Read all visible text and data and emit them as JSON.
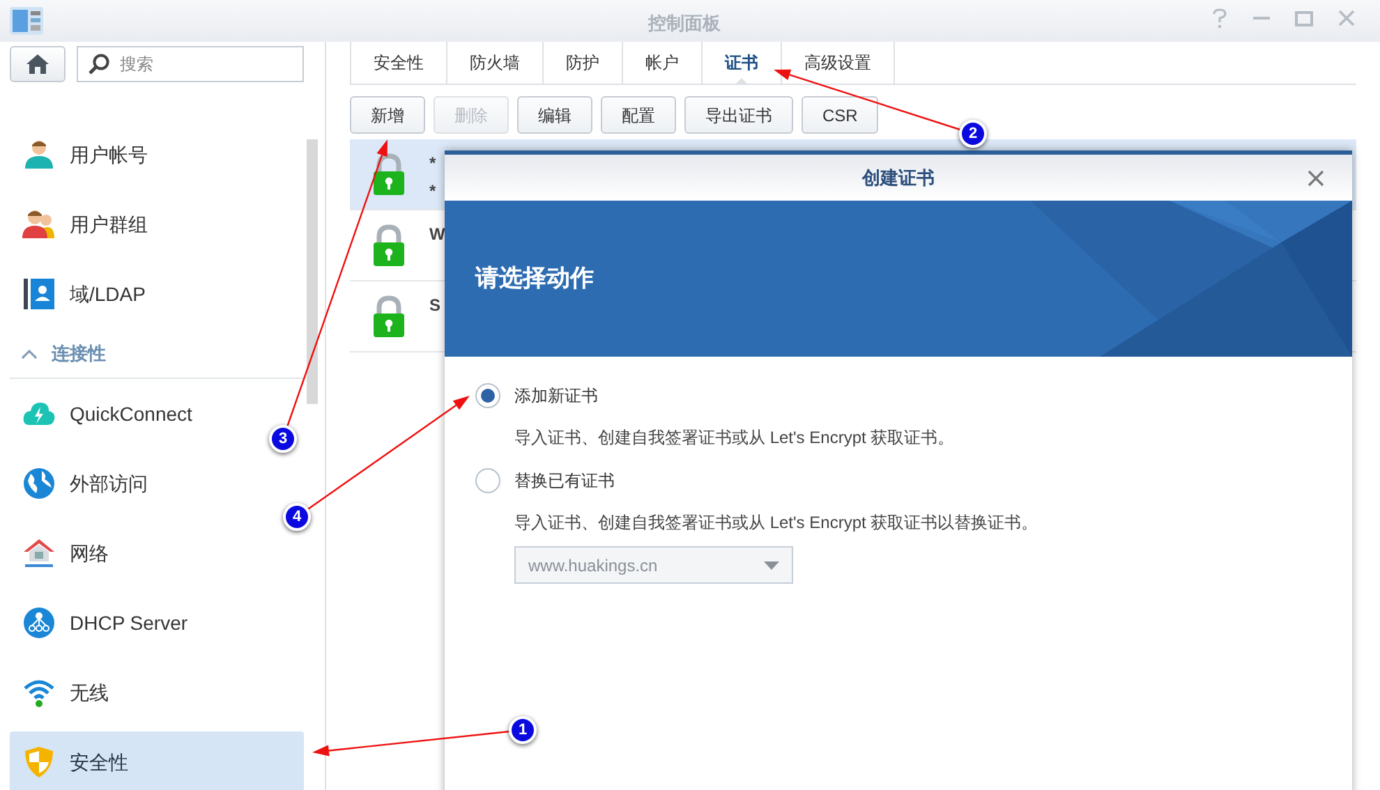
{
  "window": {
    "title": "控制面板"
  },
  "sidebar": {
    "search": {
      "placeholder": "搜索"
    },
    "items": [
      {
        "kind": "item",
        "label": "用户帐号",
        "selected": false
      },
      {
        "kind": "item",
        "label": "用户群组",
        "selected": false
      },
      {
        "kind": "item",
        "label": "域/LDAP",
        "selected": false
      },
      {
        "kind": "section",
        "label": "连接性",
        "expanded": true
      },
      {
        "kind": "item",
        "label": "QuickConnect",
        "selected": false
      },
      {
        "kind": "item",
        "label": "外部访问",
        "selected": false
      },
      {
        "kind": "item",
        "label": "网络",
        "selected": false
      },
      {
        "kind": "item",
        "label": "DHCP Server",
        "selected": false
      },
      {
        "kind": "item",
        "label": "无线",
        "selected": false
      },
      {
        "kind": "item",
        "label": "安全性",
        "selected": true
      }
    ]
  },
  "tabs": [
    {
      "label": "安全性",
      "selected": false
    },
    {
      "label": "防火墙",
      "selected": false
    },
    {
      "label": "防护",
      "selected": false
    },
    {
      "label": "帐户",
      "selected": false
    },
    {
      "label": "证书",
      "selected": true
    },
    {
      "label": "高级设置",
      "selected": false
    }
  ],
  "toolbar": [
    {
      "label": "新增",
      "disabled": false
    },
    {
      "label": "删除",
      "disabled": true
    },
    {
      "label": "编辑",
      "disabled": false
    },
    {
      "label": "配置",
      "disabled": false
    },
    {
      "label": "导出证书",
      "disabled": false
    },
    {
      "label": "CSR",
      "disabled": false
    }
  ],
  "certificates": [
    {
      "lines": [
        "*",
        "*"
      ],
      "selected": true
    },
    {
      "lines": [
        "W"
      ],
      "selected": false
    },
    {
      "lines": [
        "S"
      ],
      "selected": false
    }
  ],
  "dialog": {
    "title": "创建证书",
    "heading": "请选择动作",
    "options": [
      {
        "label": "添加新证书",
        "description": "导入证书、创建自我签署证书或从 Let's Encrypt 获取证书。",
        "selected": true
      },
      {
        "label": "替换已有证书",
        "description": "导入证书、创建自我签署证书或从 Let's Encrypt 获取证书以替换证书。",
        "selected": false
      }
    ],
    "select": {
      "value": "www.huakings.cn",
      "disabled": true
    }
  },
  "annotations": [
    {
      "number": "1"
    },
    {
      "number": "2"
    },
    {
      "number": "3"
    },
    {
      "number": "4"
    }
  ]
}
